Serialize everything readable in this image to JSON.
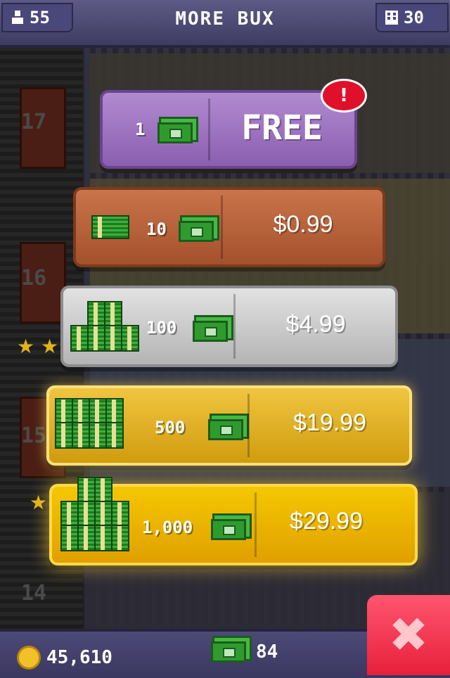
{
  "topbar": {
    "title": "MORE BUX",
    "population": "55",
    "floors": "30"
  },
  "tower": {
    "floor_numbers": [
      "17",
      "16",
      "15",
      "14"
    ]
  },
  "offers": [
    {
      "amount": "1",
      "price": "FREE",
      "badge": "!"
    },
    {
      "amount": "10",
      "price": "$0.99"
    },
    {
      "amount": "100",
      "price": "$4.99"
    },
    {
      "amount": "500",
      "price": "$19.99"
    },
    {
      "amount": "1,000",
      "price": "$29.99"
    }
  ],
  "bottombar": {
    "coins": "45,610",
    "bux": "84",
    "close_symbol": "✖"
  },
  "colors": {
    "free": "#9b6fc0",
    "bronze": "#b5603a",
    "silver": "#c8c8c8",
    "gold": "#e6b020",
    "close": "#ee2e48"
  },
  "icons": [
    "person-icon",
    "building-icon",
    "bux-bill-icon",
    "coin-icon",
    "close-icon",
    "bux-stack-icon"
  ]
}
